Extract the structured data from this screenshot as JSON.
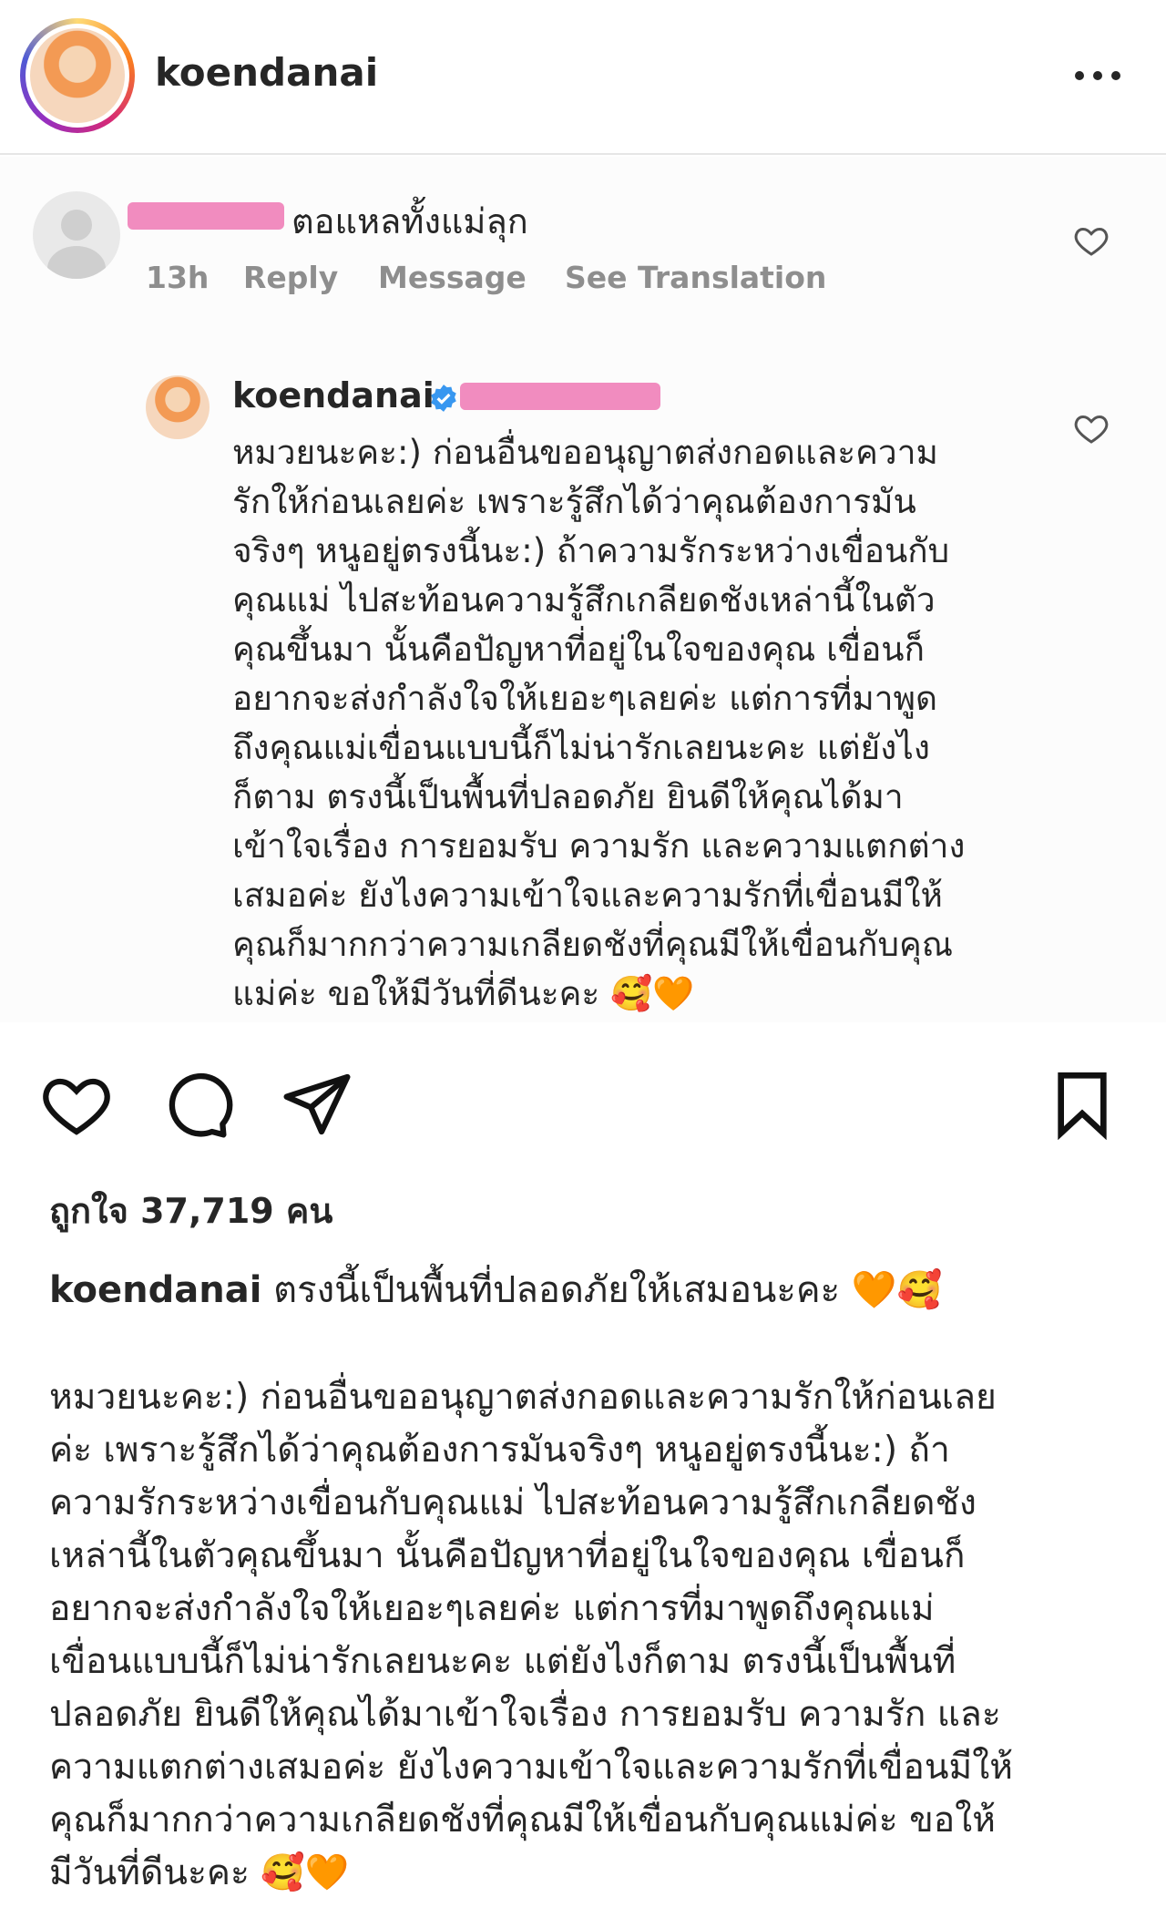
{
  "header": {
    "username": "koendanai",
    "more_icon": "more-horizontal-icon"
  },
  "comment": {
    "text": "ตอแหลทั้งแม่ลุก",
    "time": "13h",
    "reply": "Reply",
    "message": "Message",
    "see_translation": "See Translation"
  },
  "reply": {
    "username": "koendanai",
    "text": "หมวยนะคะ:) ก่อนอื่นขออนุญาตส่งกอดและความ\nรักให้ก่อนเลยค่ะ เพราะรู้สึกได้ว่าคุณต้องการมัน\nจริงๆ หนูอยู่ตรงนี้นะ:) ถ้าความรักระหว่างเขื่อนกับ\nคุณแม่ ไปสะท้อนความรู้สึกเกลียดชังเหล่านี้ในตัว\nคุณขึ้นมา นั้นคือปัญหาที่อยู่ในใจของคุณ เขื่อนก็\nอยากจะส่งกำลังใจให้เยอะๆเลยค่ะ แต่การที่มาพูด\nถึงคุณแม่เขื่อนแบบนี้ก็ไม่น่ารักเลยนะคะ แต่ยังไง\nก็ตาม ตรงนี้เป็นพื้นที่ปลอดภัย ยินดีให้คุณได้มา\nเข้าใจเรื่อง การยอมรับ ความรัก และความแตกต่าง\nเสมอค่ะ ยังไงความเข้าใจและความรักที่เขื่อนมีให้\nคุณก็มากกว่าความเกลียดชังที่คุณมีให้เขื่อนกับคุณ\nแม่ค่ะ ขอให้มีวันที่ดีนะคะ 🥰🧡"
  },
  "post": {
    "likes": "ถูกใจ 37,719 คน",
    "caption_user": "koendanai",
    "caption_head": "ตรงนี้เป็นพื้นที่ปลอดภัยให้เสมอนะคะ 🧡🥰",
    "caption_body": "หมวยนะคะ:) ก่อนอื่นขออนุญาตส่งกอดและความรักให้ก่อนเลย\nค่ะ เพราะรู้สึกได้ว่าคุณต้องการมันจริงๆ หนูอยู่ตรงนี้นะ:) ถ้า\nความรักระหว่างเขื่อนกับคุณแม่ ไปสะท้อนความรู้สึกเกลียดชัง\nเหล่านี้ในตัวคุณขึ้นมา นั้นคือปัญหาที่อยู่ในใจของคุณ เขื่อนก็\nอยากจะส่งกำลังใจให้เยอะๆเลยค่ะ แต่การที่มาพูดถึงคุณแม่\nเขื่อนแบบนี้ก็ไม่น่ารักเลยนะคะ แต่ยังไงก็ตาม ตรงนี้เป็นพื้นที่\nปลอดภัย ยินดีให้คุณได้มาเข้าใจเรื่อง การยอมรับ ความรัก และ\nความแตกต่างเสมอค่ะ ยังไงความเข้าใจและความรักที่เขื่อนมีให้\nคุณก็มากกว่าความเกลียดชังที่คุณมีให้เขื่อนกับคุณแม่ค่ะ ขอให้\nมีวันที่ดีนะคะ 🥰🧡"
  },
  "colors": {
    "text": "#262626",
    "secondary": "#8e8e8e",
    "verified": "#3897f0",
    "censor": "#f080b8"
  }
}
